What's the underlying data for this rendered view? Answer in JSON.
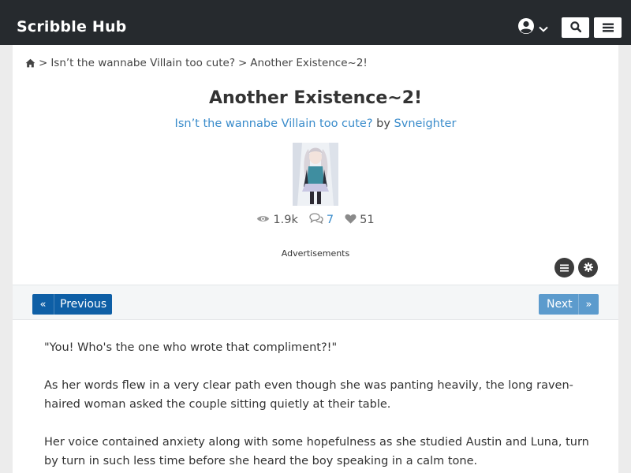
{
  "header": {
    "logo": "Scribble Hub"
  },
  "breadcrumb": {
    "series": "Isn’t the wannabe Villain too cute?",
    "chapter": "Another Existence~2!",
    "separator": ">"
  },
  "chapter": {
    "title": "Another Existence~2!",
    "series_link": "Isn’t the wannabe Villain too cute?",
    "by": "by",
    "author": "Svneighter"
  },
  "stats": {
    "views": "1.9k",
    "comments": "7",
    "likes": "51"
  },
  "ads_label": "Advertisements",
  "nav": {
    "previous": "Previous",
    "previous_arrow": "«",
    "next": "Next",
    "next_arrow": "»"
  },
  "content": {
    "paragraphs": [
      "\"You! Who's the one who wrote that compliment?!\"",
      "As her words flew in a very clear path even though she was panting heavily, the long raven-haired woman asked the couple sitting quietly at their table.",
      "Her voice contained anxiety along with some hopefulness as she studied Austin and Luna, turn by turn in such less time before she heard the boy speaking in a calm tone."
    ]
  },
  "colors": {
    "header_bg": "#262a2e",
    "link_blue": "#3a8ccb",
    "prev_button": "#0e5fa6",
    "next_button": "#5c9bcd"
  },
  "icons": {
    "home": "home-icon",
    "user": "user-circle-icon",
    "chevron": "chevron-down-icon",
    "search": "search-icon",
    "menu": "hamburger-menu-icon",
    "views": "eye-icon",
    "comments": "comments-icon",
    "likes": "heart-icon",
    "toc": "list-icon",
    "settings": "gear-icon"
  }
}
